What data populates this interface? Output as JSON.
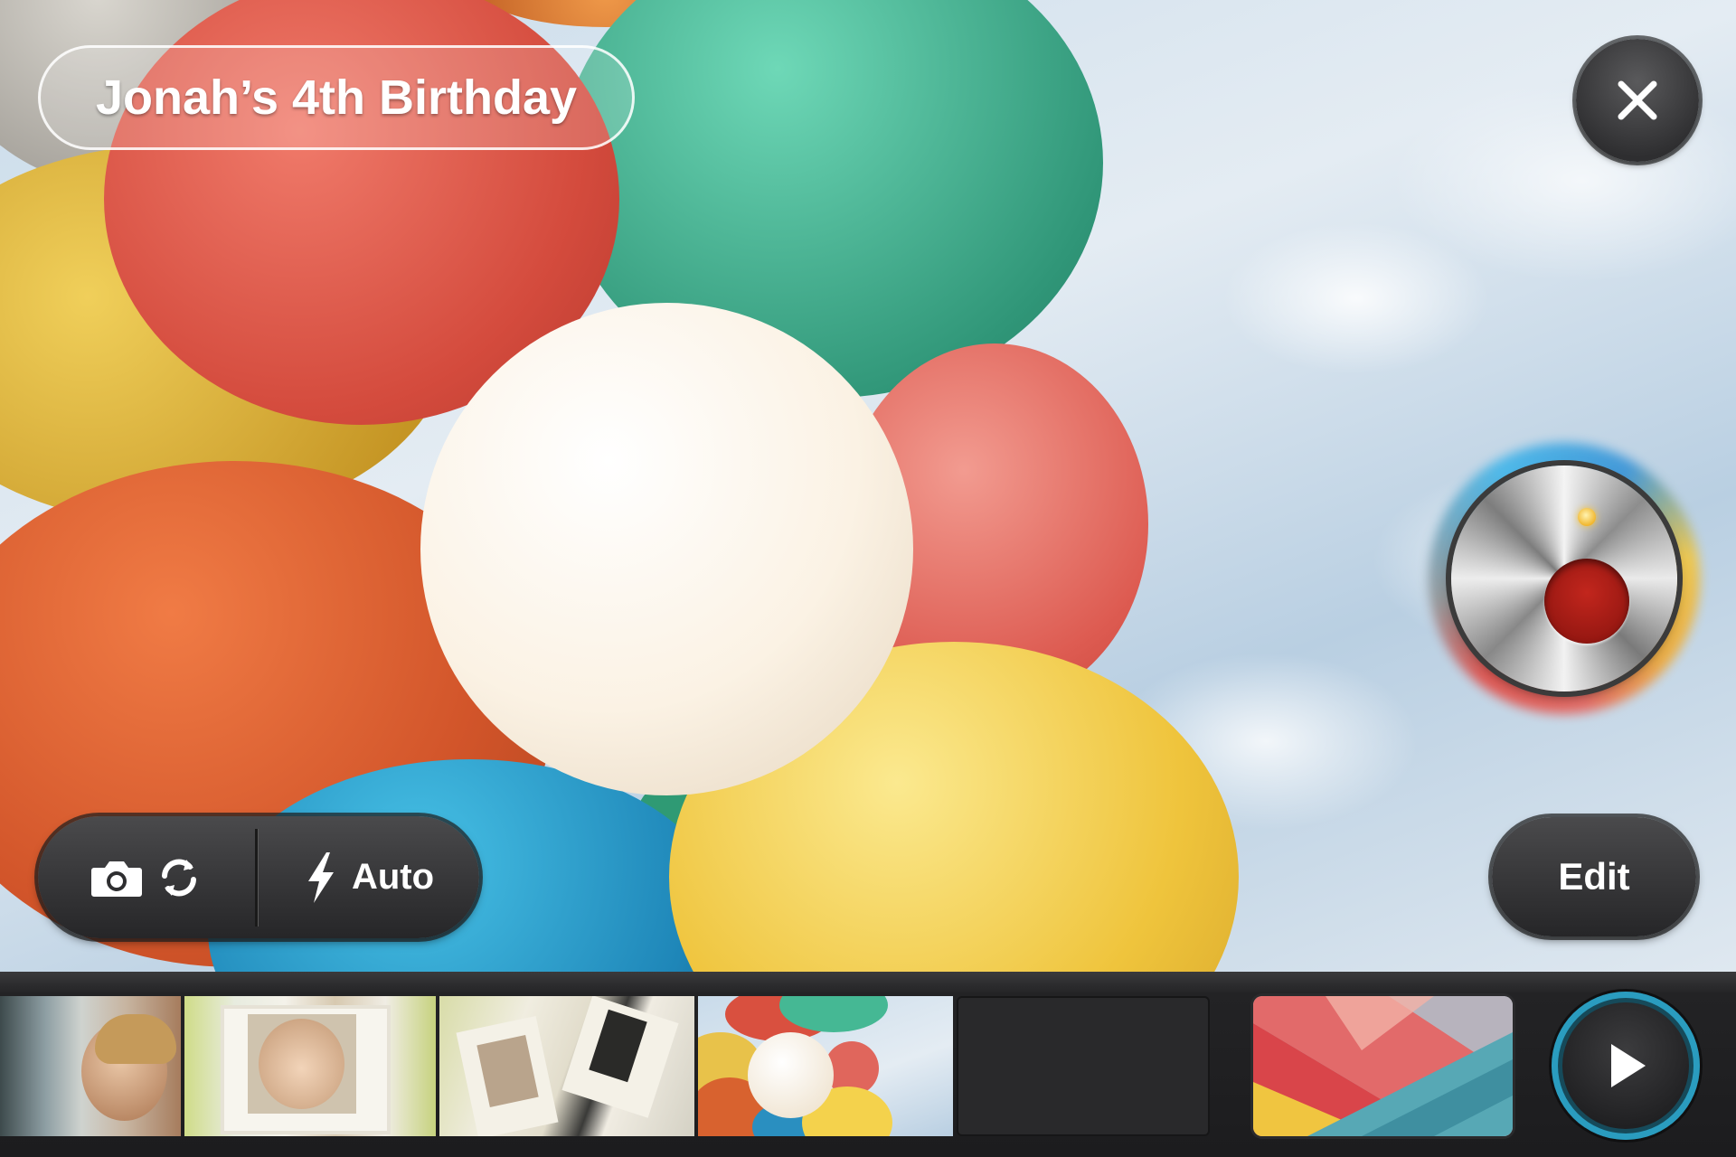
{
  "project": {
    "title": "Jonah’s 4th Birthday"
  },
  "controls": {
    "close_icon": "close-icon",
    "record_icon": "record-icon",
    "camera_switch_icons": [
      "camera-icon",
      "rotate-icon"
    ],
    "flash_icon": "lightning-bolt-icon",
    "flash_label": "Auto",
    "edit_label": "Edit",
    "play_icon": "play-icon"
  },
  "filmstrip": {
    "clips": [
      {
        "label": "child-at-window"
      },
      {
        "label": "child-in-frame"
      },
      {
        "label": "picture-frames"
      },
      {
        "label": "balloons"
      }
    ],
    "empty_slot": true,
    "theme": "geometric-color-theme"
  },
  "colors": {
    "record_red": "#a51b14",
    "play_ring": "#2a9cbf",
    "control_dark": "#2e2e30"
  }
}
